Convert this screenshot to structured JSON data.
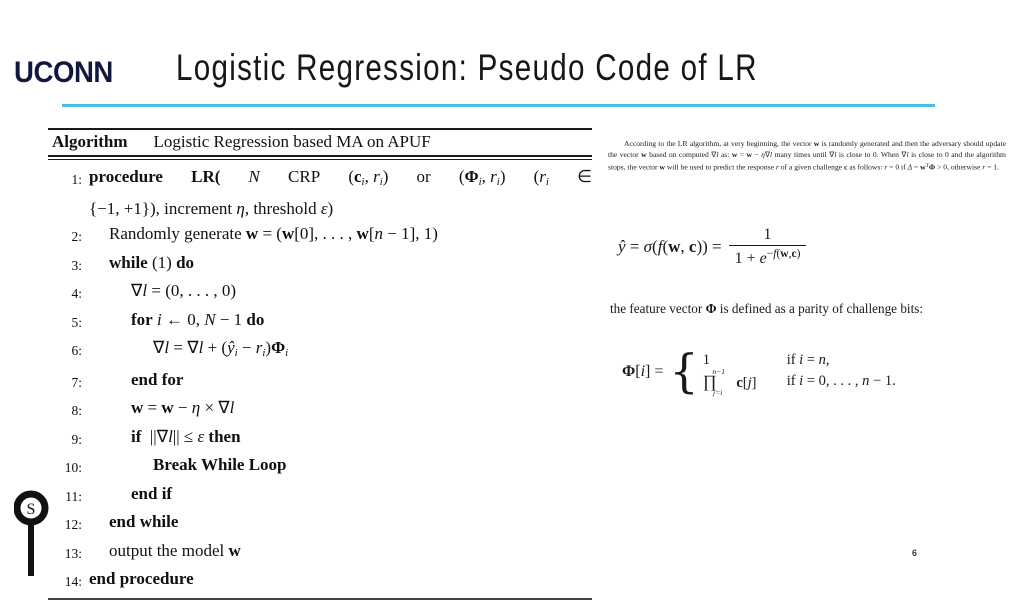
{
  "slide": {
    "brand": "UCONN",
    "title": "Logistic Regression: Pseudo Code of LR",
    "page_number": "6",
    "accent_color": "#49bde2",
    "brand_color": "#10193c"
  },
  "algorithm": {
    "caption_keyword": "Algorithm",
    "caption_name": "Logistic Regression based MA on APUF",
    "lines": [
      {
        "num": "1:",
        "indent": 0,
        "text": "procedure LR(N CRP (cᵢ, rᵢ) or (Φᵢ, rᵢ) (rᵢ ∈ {−1, +1}), increment η, threshold ϵ)"
      },
      {
        "num": "2:",
        "indent": 1,
        "text": "Randomly generate w = (w[0], . . . , w[n − 1], 1)"
      },
      {
        "num": "3:",
        "indent": 1,
        "text": "while (1) do"
      },
      {
        "num": "4:",
        "indent": 2,
        "text": "∇l = (0, . . . , 0)"
      },
      {
        "num": "5:",
        "indent": 2,
        "text": "for i ← 0, N − 1 do"
      },
      {
        "num": "6:",
        "indent": 3,
        "text": "∇l = ∇l + (ŷᵢ − rᵢ)Φᵢ"
      },
      {
        "num": "7:",
        "indent": 2,
        "text": "end for"
      },
      {
        "num": "8:",
        "indent": 2,
        "text": "w = w − η × ∇l"
      },
      {
        "num": "9:",
        "indent": 2,
        "text": "if ||∇l|| ≤ ϵ then"
      },
      {
        "num": "10:",
        "indent": 3,
        "text": "Break While Loop"
      },
      {
        "num": "11:",
        "indent": 2,
        "text": "end if"
      },
      {
        "num": "12:",
        "indent": 1,
        "text": "end while"
      },
      {
        "num": "13:",
        "indent": 1,
        "text": "output the model w"
      },
      {
        "num": "14:",
        "indent": 0,
        "text": "end procedure"
      }
    ]
  },
  "notes": {
    "paragraph": "According to the LR algorithm, at very beginning, the vector w is randomly generated and then the adversary should update the vector w based on computed ∇l as: w = w − η∇l many times until ∇l is close to 0. When ∇l is close to 0 and the algorithm stops, the vector w will be used to predict the response r of a given challenge c as follows: r = 0 if Δ = wᵀΦ > 0, otherwise r = 1.",
    "sigmoid_equation": "ŷ = σ(f(w, c)) = 1 / (1 + e^−f(w,c))",
    "sigmoid_lhs": "ŷ = σ(f(w, c)) =",
    "sigmoid_numerator": "1",
    "sigmoid_denominator": "1 + e−f(w,c)",
    "feature_text": "the feature vector Φ is defined as a parity of challenge bits:",
    "phi_equation_lhs": "Φ[i] =",
    "phi_case1_value": "1",
    "phi_case1_cond": "if i = n,",
    "phi_case2_value": "∏ⁿ⁻¹ⱼ₌ᵢ c[j]",
    "phi_case2_cond": "if i = 0, . . . , n − 1."
  },
  "icons": {
    "corner_emblem": "circular-s-emblem"
  }
}
